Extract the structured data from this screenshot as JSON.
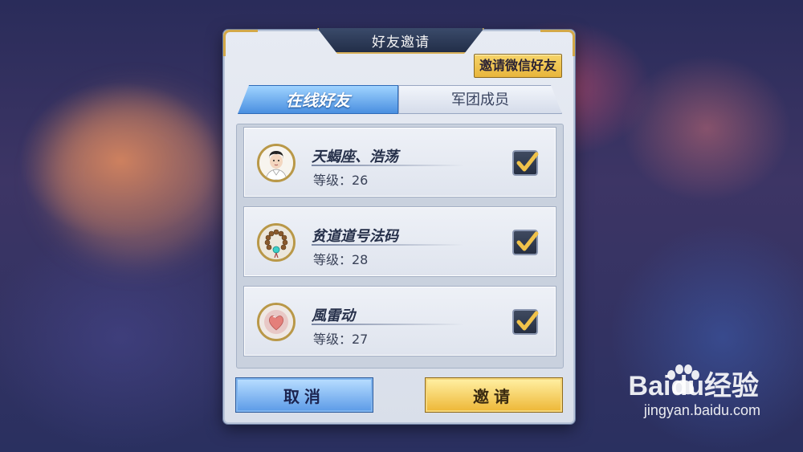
{
  "dialog": {
    "title": "好友邀请",
    "wechat_button": "邀请微信好友",
    "tabs": [
      {
        "label": "在线好友",
        "active": true
      },
      {
        "label": "军团成员",
        "active": false
      }
    ],
    "friends": [
      {
        "name": "天蝎座、浩荡",
        "level": "等级：26",
        "avatar": "man-portrait-icon",
        "checked": true
      },
      {
        "name": "贫道道号法码",
        "level": "等级：28",
        "avatar": "prayer-beads-icon",
        "checked": true
      },
      {
        "name": "風雷动",
        "level": "等级：27",
        "avatar": "heart-peach-icon",
        "checked": true
      }
    ],
    "cancel_button": "取消",
    "invite_button": "邀请"
  },
  "watermark": {
    "brand": "Baidu经验",
    "url": "jingyan.baidu.com"
  },
  "colors": {
    "accent_gold": "#e8b53c",
    "accent_blue": "#4a8fe0",
    "panel": "#dfe4ee"
  }
}
